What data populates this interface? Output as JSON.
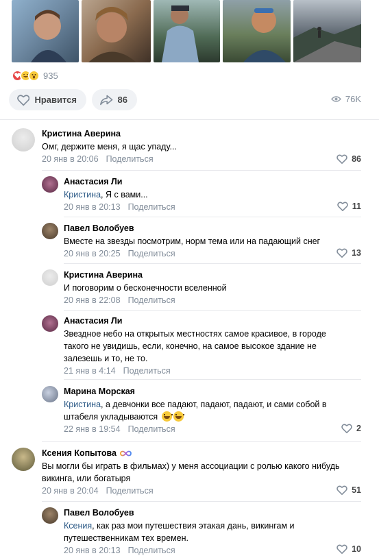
{
  "post": {
    "photos": [
      {
        "name": "photo-1",
        "bg": "#6f8aa3"
      },
      {
        "name": "photo-2",
        "bg": "#8a6a4e"
      },
      {
        "name": "photo-3",
        "bg": "#4f6a55"
      },
      {
        "name": "photo-4",
        "bg": "#6a7f5c"
      },
      {
        "name": "photo-5",
        "bg": "#5d6670"
      }
    ],
    "reactions": {
      "icons": [
        "heart-reaction-icon",
        "laughing-reaction-icon",
        "surprised-reaction-icon"
      ],
      "count": "935"
    },
    "like_button_label": "Нравится",
    "share_count": "86",
    "views": "76K"
  },
  "comments": [
    {
      "author": "Кристина Аверина",
      "text": "Омг, держите меня, я щас упаду...",
      "date": "20 янв в 20:06",
      "share": "Поделиться",
      "likes": "86",
      "avatar_color": "#d9d9d9",
      "replies": [
        {
          "author": "Анастасия Ли",
          "mention": "Кристина",
          "text": ", Я с вами...",
          "date": "20 янв в 20:13",
          "share": "Поделиться",
          "likes": "11",
          "avatar_color": "#8a4e6c"
        },
        {
          "author": "Павел Волобуев",
          "mention": "",
          "text": "Вместе на звезды посмотрим, норм тема или на падающий снег",
          "date": "20 янв в 20:25",
          "share": "Поделиться",
          "likes": "13",
          "avatar_color": "#6b5b4a"
        },
        {
          "author": "Кристина Аверина",
          "mention": "",
          "text": "И поговорим о бесконечности вселенной",
          "date": "20 янв в 22:08",
          "share": "Поделиться",
          "likes": "",
          "avatar_color": "#d9d9d9"
        },
        {
          "author": "Анастасия Ли",
          "mention": "",
          "text_lines": [
            "Звездное небо на открытых местностях самое красивое, в городе",
            "такого не увидишь, если, конечно, на самое высокое здание не",
            "залезешь и то, не то."
          ],
          "date": "21 янв в 4:14",
          "share": "Поделиться",
          "likes": "",
          "avatar_color": "#8a4e6c"
        },
        {
          "author": "Марина Морская",
          "mention": "Кристина",
          "text_lines": [
            ", а девчонки все падают, падают, падают, и сами собой в",
            "штабеля укладываются"
          ],
          "date": "22 янв в 19:54",
          "share": "Поделиться",
          "likes": "2",
          "avatar_color": "#9aa3b8"
        }
      ]
    },
    {
      "author": "Ксения Копытова",
      "text_lines": [
        "Вы могли бы играть в фильмах) у меня ассоциации с ролью какого нибудь",
        "викинга, или богатыря"
      ],
      "date": "20 янв в 20:04",
      "share": "Поделиться",
      "likes": "51",
      "avatar_color": "#8b8a62",
      "replies": [
        {
          "author": "Павел Волобуев",
          "mention": "Ксения",
          "text_lines": [
            ", как раз мои путешествия этакая дань, викингам и",
            "путешественникам тех времен."
          ],
          "date": "20 янв в 20:13",
          "share": "Поделиться",
          "likes": "10",
          "avatar_color": "#6b5b4a"
        }
      ]
    }
  ],
  "colors": {
    "accent_link": "#2a5885",
    "meta_gray": "#818c99",
    "button_bg": "#f0f2f5",
    "divider": "#e7e8ec",
    "heart_red": "#e64646"
  }
}
